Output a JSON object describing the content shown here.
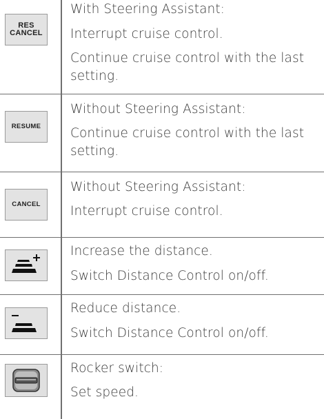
{
  "rows": [
    {
      "icon": "res-cancel-button-icon",
      "icon_lines": [
        "RES",
        "CANCEL"
      ],
      "lines": [
        "With Steering Assistant:",
        "Interrupt cruise control.",
        "Continue cruise control with the last",
        "setting."
      ]
    },
    {
      "icon": "resume-button-icon",
      "icon_lines": [
        "RESUME"
      ],
      "lines": [
        "Without Steering Assistant:",
        "Continue cruise control with the last",
        "setting."
      ]
    },
    {
      "icon": "cancel-button-icon",
      "icon_lines": [
        "CANCEL"
      ],
      "lines": [
        "Without Steering Assistant:",
        "Interrupt cruise control."
      ]
    },
    {
      "icon": "increase-distance-icon",
      "lines": [
        "Increase the distance.",
        "Switch Distance Control on/off."
      ]
    },
    {
      "icon": "reduce-distance-icon",
      "lines": [
        "Reduce distance.",
        "Switch Distance Control on/off."
      ]
    },
    {
      "icon": "rocker-switch-icon",
      "lines": [
        "Rocker switch:",
        "Set speed."
      ]
    }
  ]
}
